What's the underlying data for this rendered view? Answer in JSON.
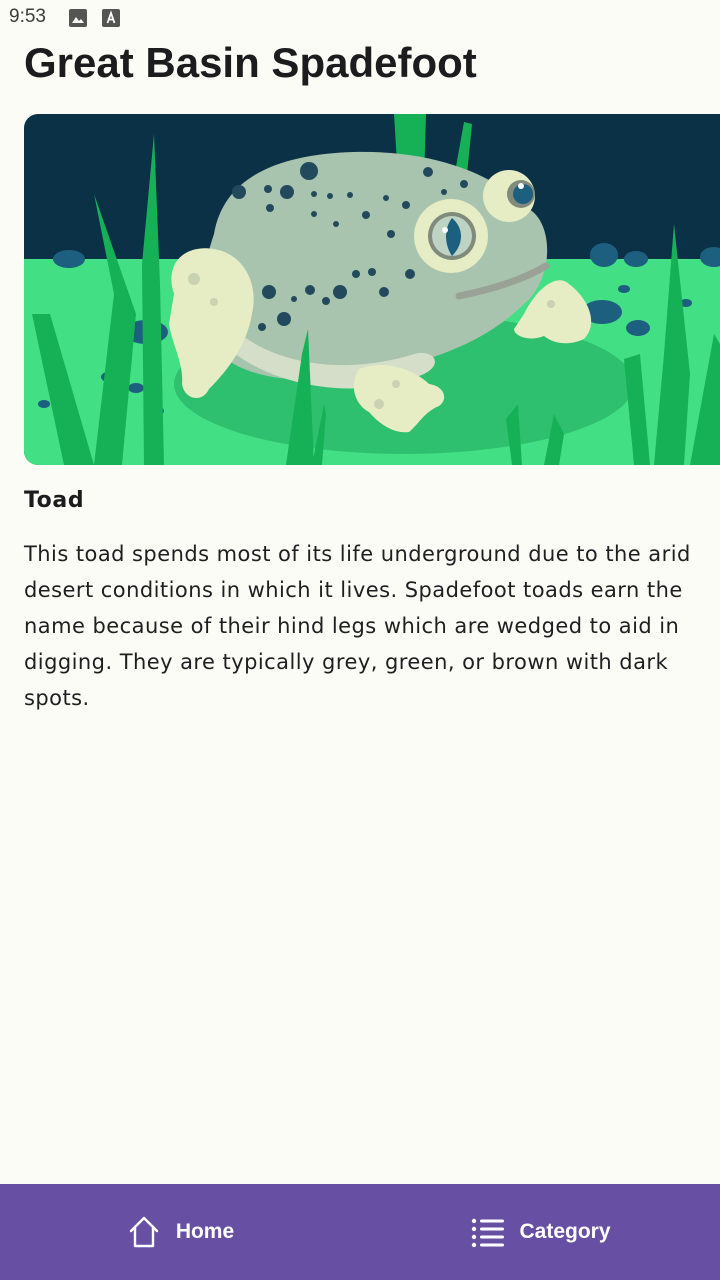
{
  "status_bar": {
    "time": "9:53",
    "icons": [
      "image-icon",
      "font-icon"
    ]
  },
  "page": {
    "title": "Great Basin Spadefoot",
    "category": "Toad",
    "description": "This toad spends most of its life underground due to the arid desert conditions in which it lives. Spadefoot toads earn the name because of their hind legs which are wedged to aid in digging. They are typically grey, green, or brown with dark spots."
  },
  "bottom_nav": {
    "items": [
      {
        "label": "Home",
        "icon": "home-icon"
      },
      {
        "label": "Category",
        "icon": "list-icon"
      }
    ]
  },
  "colors": {
    "background": "#fbfcf6",
    "nav_background": "#6750a4",
    "sky": "#0b3147",
    "grass": "#42df84",
    "text": "#1c1c1e"
  }
}
